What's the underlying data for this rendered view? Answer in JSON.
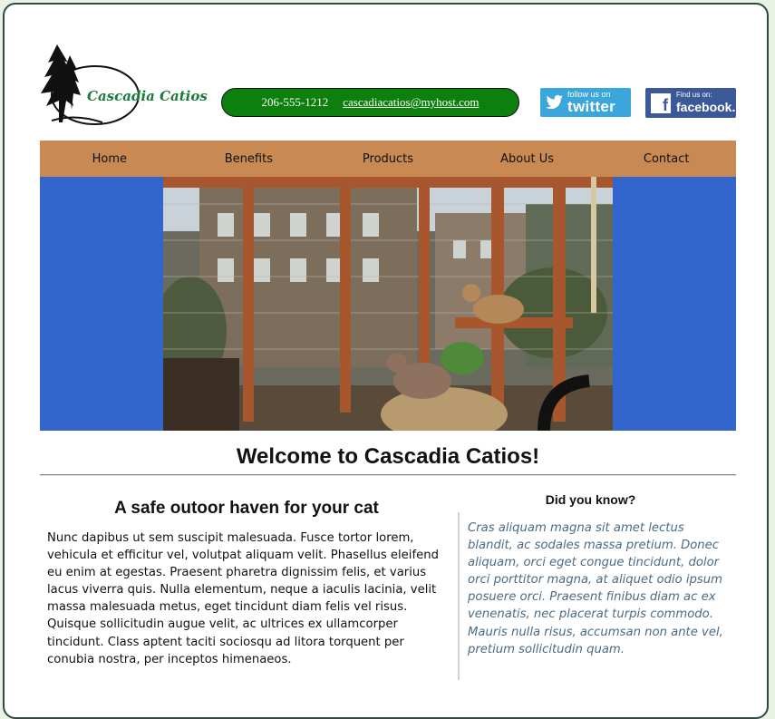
{
  "header": {
    "logo_text": "Cascadia Catios",
    "phone": "206-555-1212",
    "email": "cascadiacatios@myhost.com",
    "twitter": {
      "small": "follow us on",
      "big": "twitter",
      "icon": "twitter-bird-icon"
    },
    "facebook": {
      "small": "Find us on:",
      "big": "facebook.",
      "icon": "facebook-f-icon"
    }
  },
  "nav": {
    "items": [
      {
        "label": "Home"
      },
      {
        "label": "Benefits"
      },
      {
        "label": "Products"
      },
      {
        "label": "About Us"
      },
      {
        "label": "Contact"
      }
    ]
  },
  "hero": {
    "description": "photo"
  },
  "main": {
    "title": "Welcome to Cascadia Catios!",
    "heading": "A safe outoor haven for your cat",
    "body": "Nunc dapibus ut sem suscipit malesuada. Fusce tortor lorem, vehicula et efficitur vel, volutpat aliquam velit. Phasellus eleifend eu enim at egestas. Praesent pharetra dignissim felis, et varius lacus viverra quis. Nulla elementum, neque a iaculis lacinia, velit massa malesuada metus, eget tincidunt diam felis vel risus. Quisque sollicitudin augue velit, ac ultrices ex ullamcorper tincidunt. Class aptent taciti sociosqu ad litora torquent per conubia nostra, per inceptos himenaeos."
  },
  "aside": {
    "heading": "Did you know?",
    "body": "Cras aliquam magna sit amet lectus blandit, ac sodales massa pretium. Donec aliquam, orci eget congue tincidunt, dolor orci porttitor magna, at aliquet odio ipsum posuere orci. Praesent finibus diam ac ex venenatis, nec placerat turpis commodo. Mauris nulla risus, accumsan non ante vel, pretium sollicitudin quam."
  },
  "colors": {
    "nav": "#c88a52",
    "hero_bg": "#3366cc",
    "contact_pill": "#0c7f0c",
    "aside_text": "#4b6b86"
  }
}
